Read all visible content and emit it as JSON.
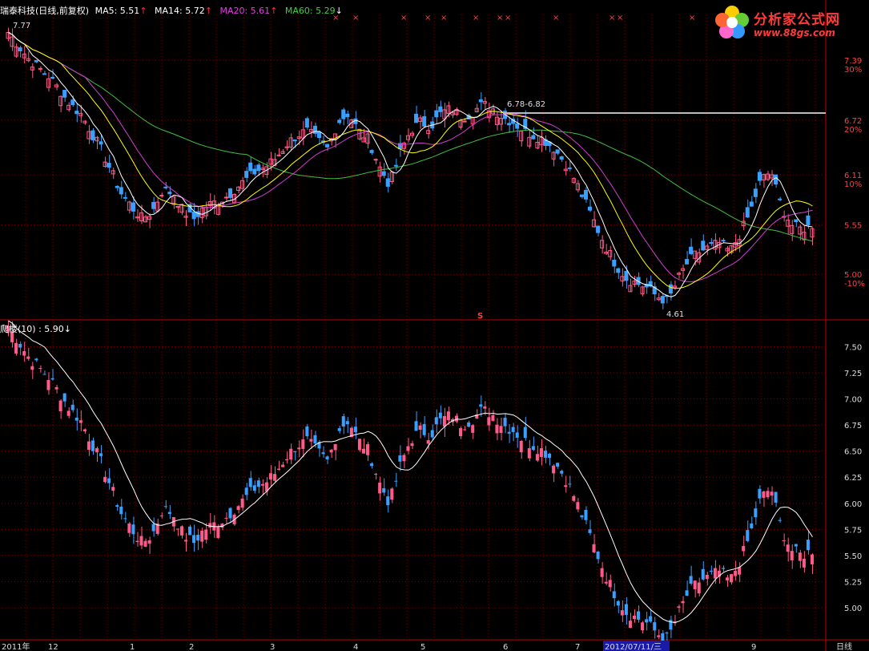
{
  "header_top": {
    "title": "瑞泰科技(日线,前复权)",
    "ma5": "MA5: 5.51",
    "ma14": "MA14: 5.72",
    "ma20": "MA20: 5.61",
    "ma60": "MA60: 5.29",
    "arrow_up": "↑",
    "arrow_down": "↓",
    "high_label": "7.77",
    "resist_label": "6.78-6.82",
    "low_label": "4.61",
    "s_mark": "S"
  },
  "header_bottom": {
    "indicator": "爬楼(10)  : 5.90",
    "arrow": "↓"
  },
  "logo": {
    "text": "分析家公式网",
    "url": "www.88gs.com"
  },
  "colors": {
    "up": "#ff5a8a",
    "down": "#3aa0ff",
    "ma5": "#ffffff",
    "ma14": "#ffff00",
    "ma20": "#d040d0",
    "ma60": "#40c040",
    "axis": "#c00000",
    "grid": "#7a0000"
  },
  "chart_data": [
    {
      "type": "candlestick",
      "title": "瑞泰科技(日线,前复权)",
      "y_ticks": [
        "7.39",
        "6.72",
        "6.11",
        "5.55",
        "5.00"
      ],
      "pct_ticks": [
        "30%",
        "20%",
        "10%",
        "",
        "-10%"
      ],
      "ylim": [
        4.5,
        7.9
      ],
      "series": [
        {
          "name": "MA5",
          "value": 5.51
        },
        {
          "name": "MA14",
          "value": 5.72
        },
        {
          "name": "MA20",
          "value": 5.61
        },
        {
          "name": "MA60",
          "value": 5.29
        }
      ],
      "close_path": [
        7.7,
        7.55,
        7.4,
        7.3,
        7.2,
        7.05,
        6.9,
        6.8,
        6.6,
        6.4,
        6.15,
        5.9,
        5.75,
        5.62,
        5.7,
        5.95,
        5.9,
        5.7,
        5.62,
        5.75,
        5.8,
        5.85,
        5.95,
        6.05,
        6.15,
        6.2,
        6.3,
        6.45,
        6.55,
        6.6,
        6.5,
        6.4,
        6.7,
        6.8,
        6.6,
        6.5,
        6.2,
        6.0,
        6.35,
        6.6,
        6.7,
        6.65,
        6.8,
        6.85,
        6.75,
        6.8,
        6.9,
        6.85,
        6.75,
        6.7,
        6.6,
        6.55,
        6.5,
        6.4,
        6.25,
        6.05,
        5.8,
        5.55,
        5.3,
        5.1,
        4.95,
        4.9,
        4.85,
        4.75,
        4.7,
        4.95,
        5.15,
        5.25,
        5.3,
        5.35,
        5.25,
        5.45,
        5.7,
        6.05,
        6.15,
        5.75,
        5.55,
        5.5,
        5.55
      ],
      "annotations": [
        "7.77",
        "6.78-6.82",
        "4.61"
      ]
    },
    {
      "type": "candlestick",
      "title": "爬楼(10)",
      "y_ticks": [
        "7.50",
        "7.25",
        "7.00",
        "6.75",
        "6.50",
        "6.25",
        "6.00",
        "5.75",
        "5.50",
        "5.25",
        "5.00"
      ],
      "ylim": [
        4.7,
        7.75
      ],
      "series": [
        {
          "name": "爬楼(10)",
          "value": 5.9
        }
      ]
    }
  ],
  "x_axis": {
    "labels": [
      "2011年",
      "12",
      "1",
      "2",
      "3",
      "4",
      "5",
      "6",
      "7",
      "2012/07/11/三",
      "9",
      "日线"
    ]
  }
}
